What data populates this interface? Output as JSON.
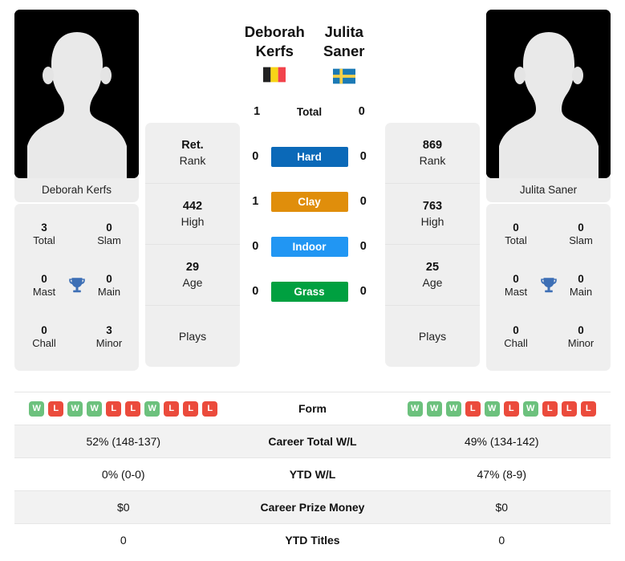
{
  "players": {
    "left": {
      "first_name": "Deborah",
      "last_name": "Kerfs",
      "full_name": "Deborah Kerfs",
      "country_flag": "belgium-flag",
      "rank": "Ret.",
      "rank_label": "Rank",
      "high": "442",
      "high_label": "High",
      "age": "29",
      "age_label": "Age",
      "plays_label": "Plays",
      "plays_value": "",
      "titles": {
        "total": "3",
        "total_label": "Total",
        "slam": "0",
        "slam_label": "Slam",
        "mast": "0",
        "mast_label": "Mast",
        "main": "0",
        "main_label": "Main",
        "chall": "0",
        "chall_label": "Chall",
        "minor": "3",
        "minor_label": "Minor"
      },
      "form": [
        "W",
        "L",
        "W",
        "W",
        "L",
        "L",
        "W",
        "L",
        "L",
        "L"
      ],
      "career_total_wl": "52% (148-137)",
      "ytd_wl": "0% (0-0)",
      "career_prize_money": "$0",
      "ytd_titles": "0"
    },
    "right": {
      "first_name": "Julita",
      "last_name": "Saner",
      "full_name": "Julita Saner",
      "country_flag": "sweden-flag",
      "rank": "869",
      "rank_label": "Rank",
      "high": "763",
      "high_label": "High",
      "age": "25",
      "age_label": "Age",
      "plays_label": "Plays",
      "plays_value": "",
      "titles": {
        "total": "0",
        "total_label": "Total",
        "slam": "0",
        "slam_label": "Slam",
        "mast": "0",
        "mast_label": "Mast",
        "main": "0",
        "main_label": "Main",
        "chall": "0",
        "chall_label": "Chall",
        "minor": "0",
        "minor_label": "Minor"
      },
      "form": [
        "W",
        "W",
        "W",
        "L",
        "W",
        "L",
        "W",
        "L",
        "L",
        "L"
      ],
      "career_total_wl": "49% (134-142)",
      "ytd_wl": "47% (8-9)",
      "career_prize_money": "$0",
      "ytd_titles": "0"
    }
  },
  "h2h": [
    {
      "label": "Total",
      "left": "1",
      "right": "0",
      "style": "plain",
      "color": ""
    },
    {
      "label": "Hard",
      "left": "0",
      "right": "0",
      "style": "badge",
      "color": "#0b69b8"
    },
    {
      "label": "Clay",
      "left": "1",
      "right": "0",
      "style": "badge",
      "color": "#e08e0b"
    },
    {
      "label": "Indoor",
      "left": "0",
      "right": "0",
      "style": "badge",
      "color": "#2196f3"
    },
    {
      "label": "Grass",
      "left": "0",
      "right": "0",
      "style": "badge",
      "color": "#00a040"
    }
  ],
  "stats_rows": [
    {
      "label": "Form",
      "type": "form",
      "left": "",
      "right": "",
      "shaded": false
    },
    {
      "label": "Career Total W/L",
      "type": "text",
      "left": "52% (148-137)",
      "right": "49% (134-142)",
      "shaded": true
    },
    {
      "label": "YTD W/L",
      "type": "text",
      "left": "0% (0-0)",
      "right": "47% (8-9)",
      "shaded": false
    },
    {
      "label": "Career Prize Money",
      "type": "text",
      "left": "$0",
      "right": "$0",
      "shaded": true
    },
    {
      "label": "YTD Titles",
      "type": "text",
      "left": "0",
      "right": "0",
      "shaded": false
    }
  ],
  "colors": {
    "hard": "#0b69b8",
    "clay": "#e08e0b",
    "indoor": "#2196f3",
    "grass": "#00a040",
    "win": "#6cc17d",
    "loss": "#eb4b3c",
    "trophy": "#3d6fb5",
    "card_bg": "#efefef"
  }
}
